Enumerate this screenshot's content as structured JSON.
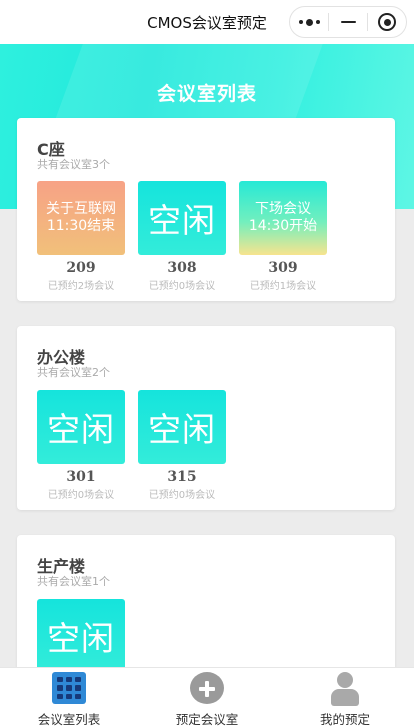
{
  "titlebar": {
    "app_title": "CMOS会议室预定",
    "more_icon": "more-dots-icon",
    "minimize_icon": "minimize-icon",
    "close_icon": "target-circle-icon"
  },
  "header": {
    "title": "会议室列表"
  },
  "buildings": [
    {
      "name": "C座",
      "count_text": "共有会议室3个",
      "rooms": [
        {
          "status": "busy",
          "line1": "关于互联网",
          "line2": "11:30结束",
          "number": "209",
          "booked": "已预约2场会议"
        },
        {
          "status": "idle",
          "line1": "空闲",
          "line2": "",
          "number": "308",
          "booked": "已预约0场会议"
        },
        {
          "status": "upcoming",
          "line1": "下场会议",
          "line2": "14:30开始",
          "number": "309",
          "booked": "已预约1场会议"
        }
      ]
    },
    {
      "name": "办公楼",
      "count_text": "共有会议室2个",
      "rooms": [
        {
          "status": "idle",
          "line1": "空闲",
          "line2": "",
          "number": "301",
          "booked": "已预约0场会议"
        },
        {
          "status": "idle",
          "line1": "空闲",
          "line2": "",
          "number": "315",
          "booked": "已预约0场会议"
        }
      ]
    },
    {
      "name": "生产楼",
      "count_text": "共有会议室1个",
      "rooms": [
        {
          "status": "idle",
          "line1": "空闲",
          "line2": "",
          "number": "",
          "booked": ""
        }
      ]
    }
  ],
  "tabbar": {
    "tabs": [
      {
        "label": "会议室列表",
        "icon": "grid-list-icon",
        "active": true
      },
      {
        "label": "预定会议室",
        "icon": "plus-circle-icon",
        "active": false
      },
      {
        "label": "我的预定",
        "icon": "user-icon",
        "active": false
      }
    ]
  },
  "colors": {
    "accent": "#2ee9dd",
    "busy_tile": "#f7a286",
    "tab_active_icon": "#2f89d6"
  }
}
